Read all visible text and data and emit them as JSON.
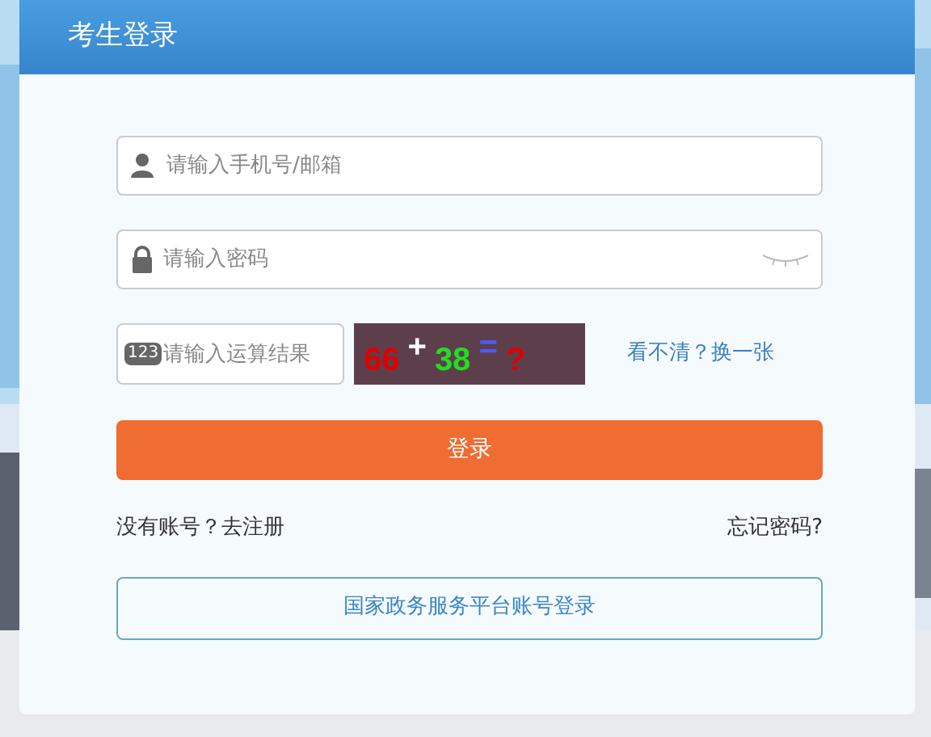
{
  "header": {
    "title": "考生登录"
  },
  "form": {
    "username": {
      "placeholder": "请输入手机号/邮箱"
    },
    "password": {
      "placeholder": "请输入密码",
      "visible": false
    },
    "captcha": {
      "badge": "123",
      "placeholder": "请输入运算结果",
      "tokens": [
        {
          "text": "66",
          "color": "#e00000"
        },
        {
          "text": "+",
          "color": "#ffffff"
        },
        {
          "text": "38",
          "color": "#22dd22"
        },
        {
          "text": "=",
          "color": "#4a5cff"
        },
        {
          "text": "?",
          "color": "#e00000"
        }
      ],
      "refresh_link": "看不清？换一张"
    },
    "login_button": "登录",
    "register_link": "没有账号？去注册",
    "forgot_link": "忘记密码?",
    "gov_login_button": "国家政务服务平台账号登录"
  }
}
